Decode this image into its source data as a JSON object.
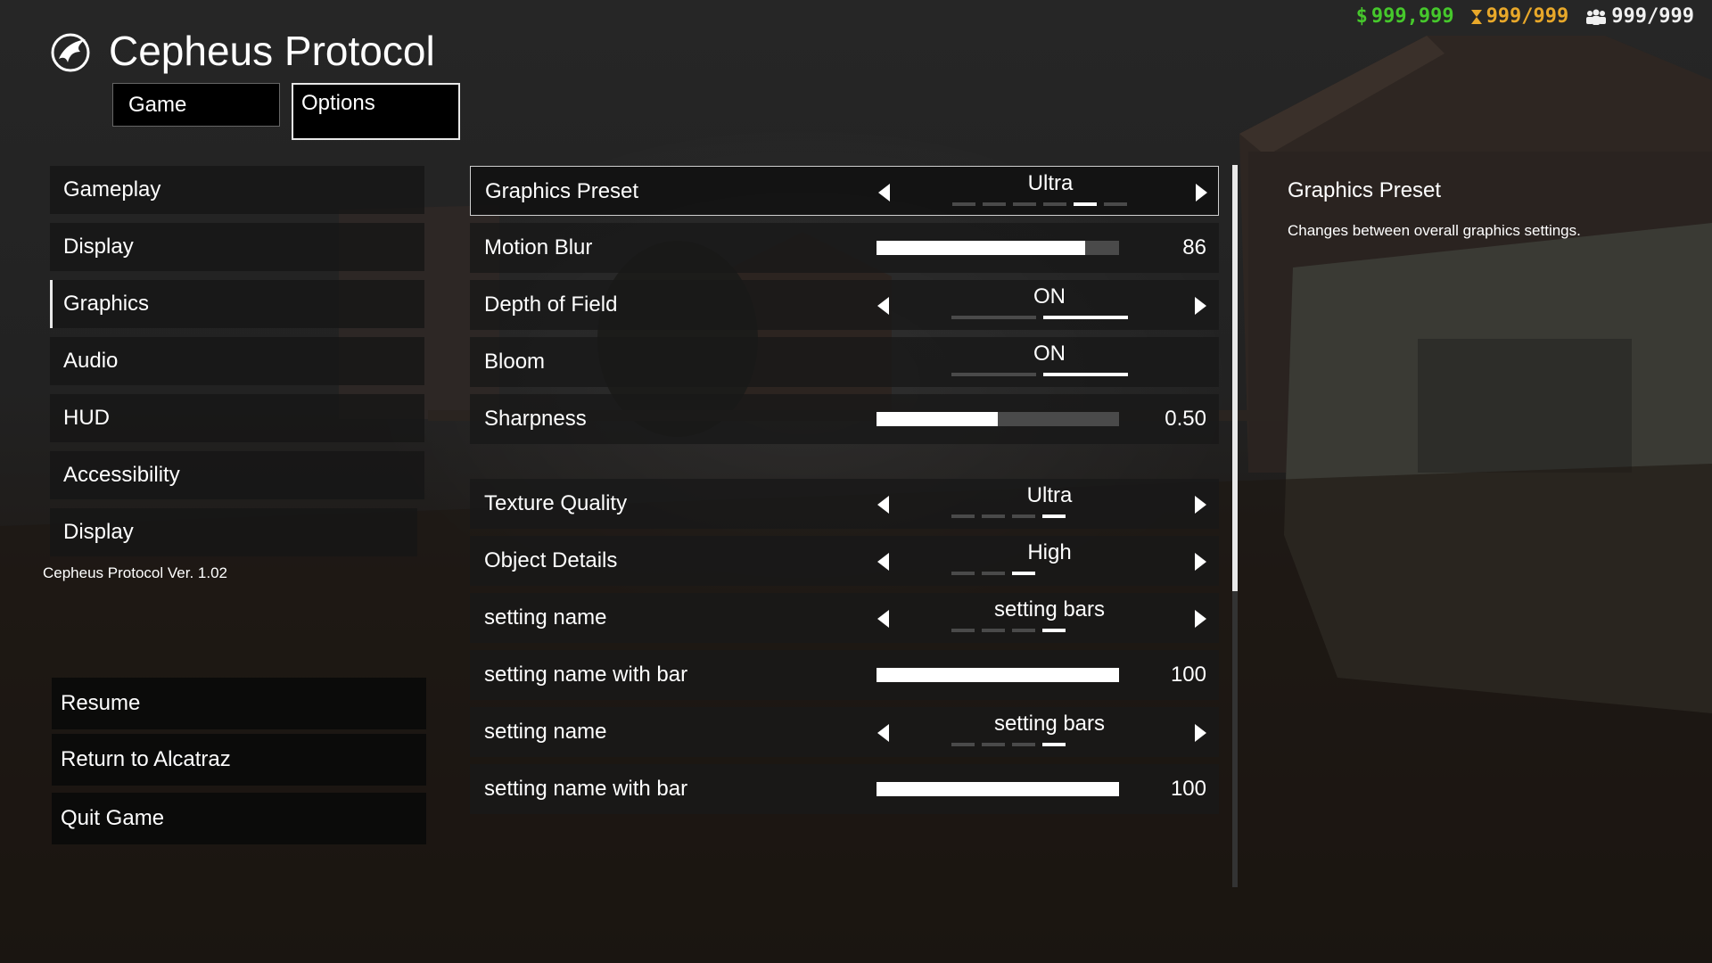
{
  "fps": "",
  "hud": {
    "money": "999,999",
    "money_symbol": "$",
    "time": "999/999",
    "players": "999/999",
    "colors": {
      "money": "#46c82c",
      "time": "#e8a82a",
      "players": "#f0f0f0"
    }
  },
  "app": {
    "title": "Cepheus Protocol",
    "logo_icon": "hawk-emblem-icon",
    "version": "Cepheus Protocol Ver. 1.02"
  },
  "tabs": [
    {
      "label": "Game",
      "active": false
    },
    {
      "label": "Options",
      "active": true
    }
  ],
  "sidebar": {
    "items": [
      {
        "label": "Gameplay",
        "active": false
      },
      {
        "label": "Display",
        "active": false
      },
      {
        "label": "Graphics",
        "active": true
      },
      {
        "label": "Audio",
        "active": false
      },
      {
        "label": "HUD",
        "active": false
      },
      {
        "label": "Accessibility",
        "active": false
      },
      {
        "label": "Display",
        "active": false
      }
    ]
  },
  "actions": [
    {
      "label": "Resume"
    },
    {
      "label": "Return to Alcatraz"
    },
    {
      "label": "Quit Game"
    }
  ],
  "settings": [
    {
      "label": "Graphics Preset",
      "type": "selector",
      "value": "Ultra",
      "level": 5,
      "levels": 6,
      "arrows": true,
      "selected": true
    },
    {
      "label": "Motion Blur",
      "type": "slider",
      "value": "86",
      "fraction": 0.86
    },
    {
      "label": "Depth of Field",
      "type": "selector",
      "value": "ON",
      "level": 2,
      "levels": 2,
      "arrows": true
    },
    {
      "label": "Bloom",
      "type": "selector",
      "value": "ON",
      "level": 2,
      "levels": 2,
      "arrows": false
    },
    {
      "label": "Sharpness",
      "type": "slider",
      "value": "0.50",
      "fraction": 0.5
    },
    {
      "label": "Texture Quality",
      "type": "selector",
      "value": "Ultra",
      "level": 4,
      "levels": 4,
      "arrows": true
    },
    {
      "label": "Object Details",
      "type": "selector",
      "value": "High",
      "level": 3,
      "levels": 3,
      "arrows": true
    },
    {
      "label": "setting name",
      "type": "selector",
      "value": "setting bars",
      "level": 4,
      "levels": 4,
      "arrows": true
    },
    {
      "label": "setting name with bar",
      "type": "slider",
      "value": "100",
      "fraction": 1.0
    },
    {
      "label": "setting name",
      "type": "selector",
      "value": "setting bars",
      "level": 4,
      "levels": 4,
      "arrows": true
    },
    {
      "label": "setting name with bar",
      "type": "slider",
      "value": "100",
      "fraction": 1.0
    }
  ],
  "scroll": {
    "fraction_visible": 0.59
  },
  "description": {
    "title": "Graphics Preset",
    "text": "Changes between overall graphics settings."
  }
}
